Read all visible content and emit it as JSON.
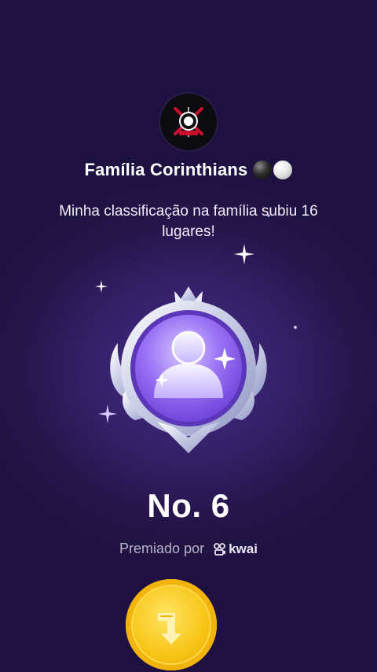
{
  "family": {
    "name": "Família Corinthians",
    "avatar_icon": "corinthians-crest-icon",
    "title_emoji": [
      "black-ball",
      "white-ball"
    ]
  },
  "message": "Minha classificação na família subiu 16 lugares!",
  "rank_label": "No. 6",
  "awarded_by": {
    "prefix": "Premiado por",
    "brand": "kwai",
    "brand_icon": "kwai-logo-icon"
  },
  "action_button": {
    "icon": "coin-share-arrow-icon"
  },
  "colors": {
    "background": "#241448",
    "badge_purple": "#8b5cf6",
    "coin_gold": "#f7c414",
    "secondary_text": "#b9b2c9"
  }
}
